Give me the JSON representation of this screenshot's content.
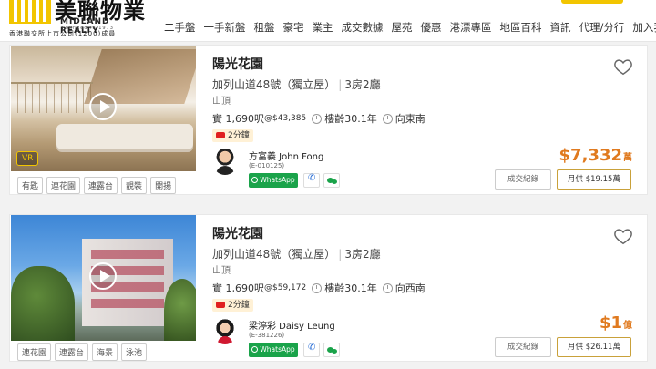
{
  "header": {
    "logo_cn": "美聯物業",
    "logo_en": "MIDLAND REALTY",
    "logo_est": "Founded in 1973",
    "logo_sub": "香港聯交所上市公司(1200)成員",
    "nav": [
      "二手盤",
      "一手新盤",
      "租盤",
      "豪宅",
      "業主",
      "成交數據",
      "屋苑",
      "優惠",
      "港漂專區",
      "地區百科",
      "資訊",
      "代理/分行",
      "加入我們"
    ]
  },
  "listings": [
    {
      "title": "陽光花園",
      "address": "加列山道48號（獨立屋）",
      "layout": "3房2廳",
      "district": "山頂",
      "area_prefix": "實 1,690呎",
      "unit_price": "@$43,385",
      "age": "樓齡30.1年",
      "facing": "向東南",
      "video_label": "2分鐘",
      "vr_label": "VR",
      "tags": [
        "有匙",
        "連花園",
        "連露台",
        "靚裝",
        "開揚"
      ],
      "agent_name": "方富義 John Fong",
      "agent_license": "(E-010125)",
      "whatsapp_label": "WhatsApp",
      "price_value": "$7,332",
      "price_unit": "萬",
      "records_label": "成交紀錄",
      "mortgage_label": "月供 $19.15萬"
    },
    {
      "title": "陽光花園",
      "address": "加列山道48號（獨立屋）",
      "layout": "3房2廳",
      "district": "山頂",
      "area_prefix": "實 1,690呎",
      "unit_price": "@$59,172",
      "age": "樓齡30.1年",
      "facing": "向西南",
      "video_label": "2分鐘",
      "tags": [
        "連花園",
        "連露台",
        "海景",
        "泳池"
      ],
      "agent_name": "梁渟彩 Daisy Leung",
      "agent_license": "(E-381226)",
      "whatsapp_label": "WhatsApp",
      "price_value": "$1",
      "price_unit": "億",
      "records_label": "成交紀錄",
      "mortgage_label": "月供 $26.11萬"
    }
  ],
  "colors": {
    "brand_yellow": "#f2c500",
    "price_orange": "#e07a1f",
    "whatsapp_green": "#1aa34a"
  }
}
